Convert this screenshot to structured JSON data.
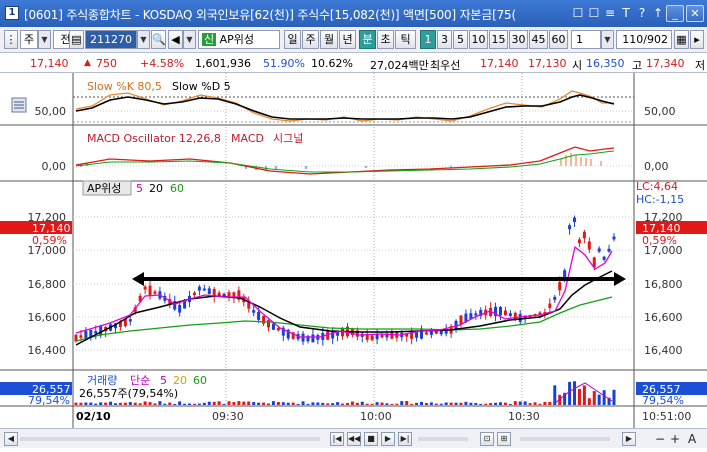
{
  "window": {
    "app_icon": "1",
    "title": "[0601] 주식종합차트 - KOSDAQ 외국인보유[62(천)] 주식수[15,082(천)] 액면[500] 자본금[75("
  },
  "titlebar_buttons": [
    "☐",
    "☐",
    "≡",
    "T",
    "?",
    "↑"
  ],
  "toolbar": {
    "market": "주",
    "period": "전",
    "code": "211270",
    "stock_name": "AP위성",
    "tabs": [
      "일",
      "주",
      "월",
      "년",
      "분",
      "초",
      "틱"
    ],
    "selected_tab": "분",
    "intervals": [
      "1",
      "3",
      "5",
      "10",
      "15",
      "30",
      "45",
      "60"
    ],
    "selected_interval": "1",
    "interval_select": "1",
    "count": "110/902"
  },
  "infobar": {
    "price": "17,140",
    "change": "750",
    "change_pct": "+4.58%",
    "volume": "1,601,936",
    "ratio1": "51.90%",
    "ratio2": "10.62%",
    "amount": "27,024백만",
    "pref_label": "최우선",
    "bid": "17,140",
    "ask": "17,130",
    "open_label": "시",
    "open": "16,350",
    "high_label": "고",
    "high": "17,340",
    "more": "저"
  },
  "panels": {
    "stoch": {
      "label1": "Slow %K 80,5",
      "label2": "Slow %D 5",
      "axis": "50,00",
      "axis_right": "50,00"
    },
    "macd": {
      "label1": "MACD Oscillator 12,26,8",
      "label2": "MACD",
      "label3": "시그널",
      "axis": "0,00",
      "axis_right": "0,00"
    },
    "price": {
      "name": "AP위성",
      "ma1": "5",
      "ma2": "20",
      "ma3": "60",
      "current": "17,140",
      "current_pct": "0,59%",
      "lc": "LC:4,64",
      "hc": "HC:-1,15",
      "yticks": [
        "17,200",
        "17,000",
        "16,800",
        "16,600",
        "16,400"
      ]
    },
    "volume": {
      "label": "거래량",
      "ma_label": "단순",
      "ma1": "5",
      "ma2": "20",
      "ma3": "60",
      "detail": "26,557주(79,54%)",
      "current": "26,557",
      "current_pct": "79,54%"
    }
  },
  "xaxis": {
    "date": "02/10",
    "ticks": [
      "09:30",
      "10:00",
      "10:30"
    ],
    "time_right": "10:51:00"
  },
  "colors": {
    "up": "#e01818",
    "down": "#1a3fd6",
    "ma5": "#e000e0",
    "ma20": "#000000",
    "ma60": "#12a012"
  },
  "chart_data": {
    "type": "candlestick",
    "yaxis_ticks": [
      16400,
      16600,
      16800,
      17000,
      17200
    ],
    "current_price": 17140,
    "trend_line_level": 16830,
    "moving_averages": [
      "5",
      "20",
      "60"
    ]
  }
}
